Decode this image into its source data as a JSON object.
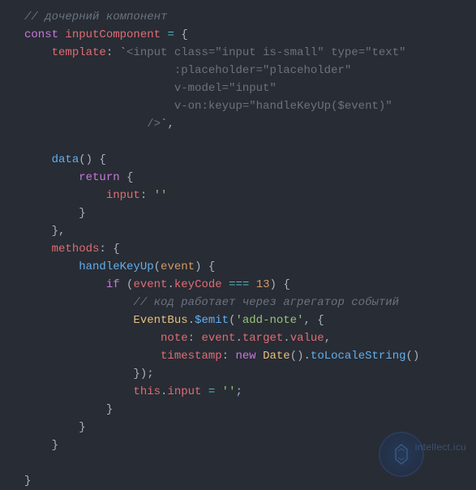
{
  "code": {
    "comment_top": "// дочерний компонент",
    "kw_const": "const",
    "var_name": "inputComponent",
    "eq": " = ",
    "brace_open": "{",
    "prop_template": "template",
    "colon": ": ",
    "template_line1": "<input class=\"input is-small\" type=\"text\"",
    "template_line2": ":placeholder=\"placeholder\"",
    "template_line3": "v-model=\"input\"",
    "template_line4": "v-on:keyup=\"handleKeyUp($event)\"",
    "template_line5": "/>",
    "backtick": "`",
    "comma": ",",
    "fn_data": "data",
    "paren_empty": "()",
    "brace_open2": " {",
    "kw_return": "return",
    "prop_input": "input",
    "str_empty": "''",
    "brace_close": "}",
    "prop_methods": "methods",
    "fn_handle": "handleKeyUp",
    "param_event": "event",
    "kw_if": "if",
    "cond_open": " (",
    "obj_event": "event",
    "dot": ".",
    "prop_keyCode": "keyCode",
    "op_eqeqeq": " === ",
    "num_13": "13",
    "cond_close": ") {",
    "comment_inner": "// код работает через агрегатор событий",
    "class_EventBus": "EventBus",
    "fn_emit": "$emit",
    "str_addnote": "'add-note'",
    "comma_sp": ", ",
    "prop_note": "note",
    "prop_target": "target",
    "prop_value": "value",
    "prop_timestamp": "timestamp",
    "kw_new": "new",
    "class_Date": "Date",
    "fn_toLocale": "toLocaleString",
    "brace_close_semi": "});",
    "kw_this": "this",
    "eq_assign": " = ",
    "semicolon": ";"
  },
  "watermark": {
    "text": "intellect.icu"
  }
}
